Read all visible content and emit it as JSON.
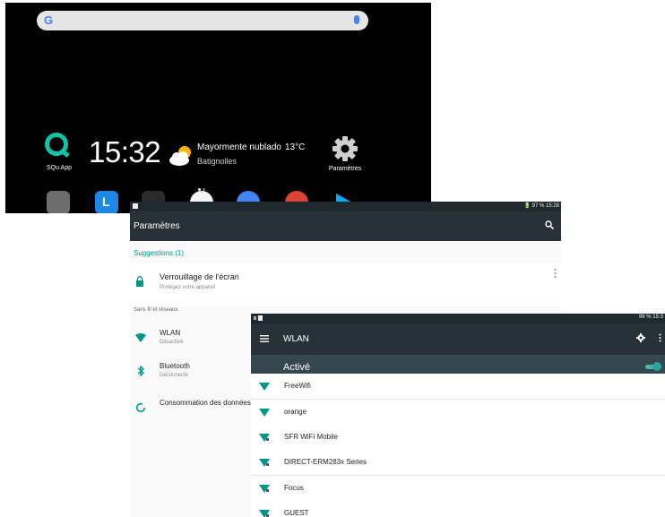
{
  "home": {
    "search_logo": "G",
    "squ_app_label": "SQu App",
    "clock": "15:32",
    "weather_desc": "Mayormente nublado",
    "weather_temp": "13°C",
    "weather_location": "Batignolles",
    "params_label": "Paramètres",
    "dock_icons": [
      "mail-icon",
      "l-app-icon",
      "hp-icon",
      "messages-icon",
      "chrome-icon",
      "play-store-icon"
    ]
  },
  "settings": {
    "status_time": "🔋 97 %  15:28",
    "title": "Paramètres",
    "suggestions": "Suggestions (1)",
    "lock_title": "Verrouillage de l'écran",
    "lock_subtitle": "Protégez votre appareil",
    "section": "Sans fil et réseaux",
    "items": [
      {
        "title": "WLAN",
        "subtitle": "Désactivé"
      },
      {
        "title": "Bluetooth",
        "subtitle": "Déconnecté"
      },
      {
        "title": "Consommation des données",
        "subtitle": ""
      }
    ]
  },
  "wlan": {
    "status_right": "96 %  15:3",
    "title": "WLAN",
    "active_label": "Activé",
    "toggle_on": true,
    "networks": [
      "FreeWifi",
      "orange",
      "SFR WiFi Mobile",
      "DIRECT-ERM283x Series",
      "Focus",
      "GUEST"
    ]
  },
  "colors": {
    "toolbar": "#263238",
    "accent": "#009688",
    "active_bar": "#37474f"
  }
}
